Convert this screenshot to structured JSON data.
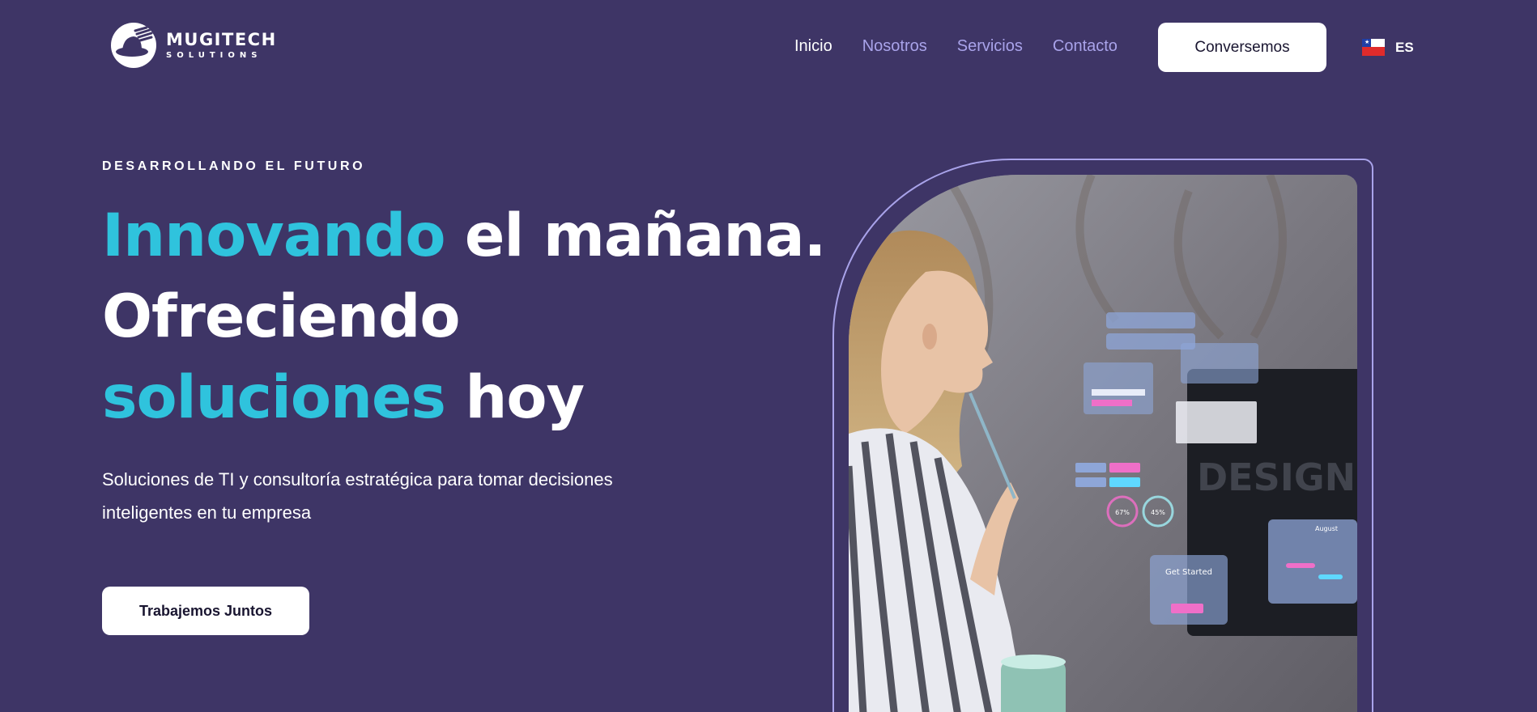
{
  "header": {
    "logo": {
      "title": "MUGITECH",
      "subtitle": "SOLUTIONS",
      "icon": "hat-hand-icon"
    },
    "nav": [
      {
        "label": "Inicio",
        "active": true
      },
      {
        "label": "Nosotros",
        "active": false
      },
      {
        "label": "Servicios",
        "active": false
      },
      {
        "label": "Contacto",
        "active": false
      }
    ],
    "cta_label": "Conversemos",
    "language": {
      "label": "ES",
      "flag": "chile-flag-icon"
    }
  },
  "hero": {
    "eyebrow": "DESARROLLANDO EL FUTURO",
    "headline": {
      "line1_accent": "Innovando",
      "line1_plain": "el mañana.",
      "line2_plain": "Ofreciendo",
      "line3_accent": "soluciones",
      "line3_plain": "hoy"
    },
    "subtitle": "Soluciones de TI y consultoría estratégica para tomar decisiones inteligentes en tu empresa",
    "cta_label": "Trabajemos Juntos",
    "image": {
      "overlay_texts": [
        "Get Started",
        "August",
        "67%",
        "45%",
        "DESIGN"
      ]
    }
  },
  "colors": {
    "background": "#3e3566",
    "accent": "#2fc3dd",
    "nav_link": "#a9a3ea",
    "button_bg": "#ffffff",
    "button_text": "#191530"
  }
}
